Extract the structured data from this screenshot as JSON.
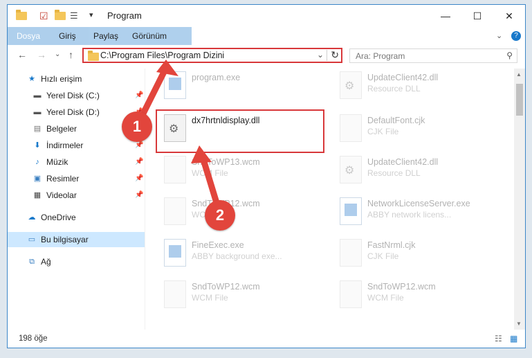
{
  "window": {
    "title": "Program",
    "controls": {
      "minimize": "—",
      "maximize": "☐",
      "close": "✕"
    }
  },
  "ribbon": {
    "tabs": [
      "Dosya",
      "Giriş",
      "Paylaş",
      "Görünüm"
    ],
    "help": "?"
  },
  "address": {
    "path": "C:\\Program Files\\Program Dizini"
  },
  "search": {
    "placeholder": "Ara: Program"
  },
  "sidebar": {
    "items": [
      {
        "label": "Hızlı erişim",
        "icon": "star-icon"
      },
      {
        "label": "Yerel Disk (C:)",
        "icon": "drive-icon"
      },
      {
        "label": "Yerel Disk (D:)",
        "icon": "drive-icon"
      },
      {
        "label": "Belgeler",
        "icon": "documents-icon"
      },
      {
        "label": "İndirmeler",
        "icon": "downloads-icon"
      },
      {
        "label": "Müzik",
        "icon": "music-icon"
      },
      {
        "label": "Resimler",
        "icon": "pictures-icon"
      },
      {
        "label": "Videolar",
        "icon": "videos-icon"
      },
      {
        "label": "OneDrive",
        "icon": "cloud-icon"
      },
      {
        "label": "Bu bilgisayar",
        "icon": "computer-icon"
      },
      {
        "label": "Ağ",
        "icon": "network-icon"
      }
    ]
  },
  "files": [
    {
      "name": "program.exe",
      "type": ""
    },
    {
      "name": "UpdateClient42.dll",
      "type": "Resource DLL"
    },
    {
      "name": "dx7hrtnldisplay.dll",
      "type": ""
    },
    {
      "name": "DefaultFont.cjk",
      "type": "CJK File"
    },
    {
      "name": "SndToWP13.wcm",
      "type": "WCM File"
    },
    {
      "name": "UpdateClient42.dll",
      "type": "Resource DLL"
    },
    {
      "name": "SndToWP12.wcm",
      "type": "WCM File"
    },
    {
      "name": "NetworkLicenseServer.exe",
      "type": "ABBY network licens..."
    },
    {
      "name": "FineExec.exe",
      "type": "ABBY background exe..."
    },
    {
      "name": "FastNrml.cjk",
      "type": "CJK File"
    },
    {
      "name": "SndToWP12.wcm",
      "type": "WCM File"
    },
    {
      "name": "SndToWP12.wcm",
      "type": "WCM File"
    }
  ],
  "status": {
    "count": "198 öğe"
  },
  "annotations": {
    "badge1": "1",
    "badge2": "2"
  },
  "colors": {
    "accent": "#1979ca",
    "highlight": "#d8383a",
    "selected": "#cde8ff"
  }
}
